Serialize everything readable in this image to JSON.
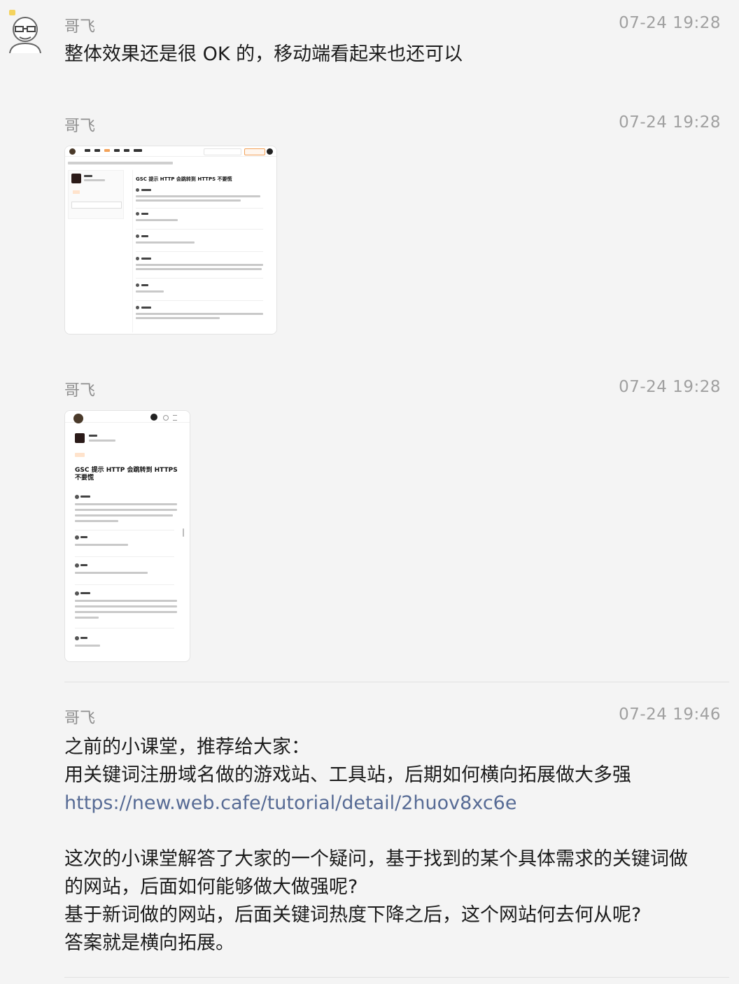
{
  "messages": [
    {
      "sender": "哥飞",
      "time": "07-24 19:28",
      "text": "整体效果还是很 OK 的，移动端看起来也还可以"
    },
    {
      "sender": "哥飞",
      "time": "07-24 19:28"
    },
    {
      "sender": "哥飞",
      "time": "07-24 19:28"
    },
    {
      "sender": "哥飞",
      "time": "07-24 19:46",
      "lines": [
        "之前的小课堂，推荐给大家：",
        "用关键词注册域名做的游戏站、工具站，后期如何横向拓展做大多强",
        "https://new.web.cafe/tutorial/detail/2huov8xc6e",
        "这次的小课堂解答了大家的一个疑问，基于找到的某个具体需求的关键词做",
        "的网站，后面如何能够做大做强呢?",
        "基于新词做的网站，后面关键词热度下降之后，这个网站何去何从呢?",
        "答案就是横向拓展。"
      ]
    }
  ],
  "screenshot_desktop": {
    "post_title": "GSC 提示 HTTP 会跳转到 HTTPS 不要慌"
  },
  "screenshot_mobile": {
    "post_title": "GSC 提示 HTTP 会跳转到 HTTPS 不要慌"
  },
  "colors": {
    "link": "#576b95",
    "meta": "#a0a0a0",
    "accent": "#f2a25a"
  }
}
